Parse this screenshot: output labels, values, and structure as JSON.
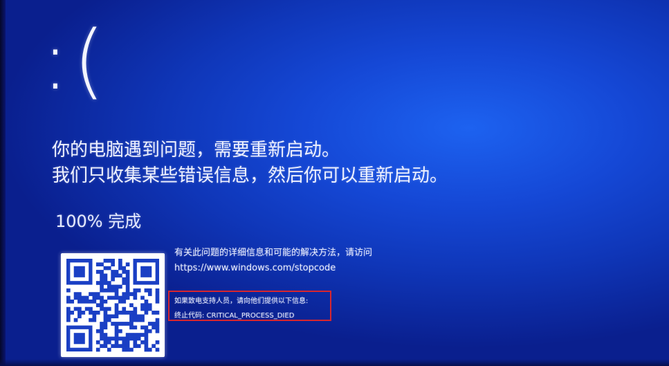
{
  "screen": {
    "sad_face": ":(",
    "message_line1": "你的电脑遇到问题，需要重新启动。",
    "message_line2": "我们只收集某些错误信息，然后你可以重新启动。",
    "progress_text": "100% 完成",
    "info_line": "有关此问题的详细信息和可能的解决方法，请访问",
    "url": "https://www.windows.com/stopcode",
    "support_line": "如果致电支持人员，请向他们提供以下信息:",
    "stop_code_line": "终止代码: CRITICAL_PROCESS_DIED"
  },
  "colors": {
    "background": "#1548d6",
    "text": "#eef1ff",
    "highlight_box": "#d8262e"
  },
  "icons": {
    "qr": "qr-code-icon"
  }
}
